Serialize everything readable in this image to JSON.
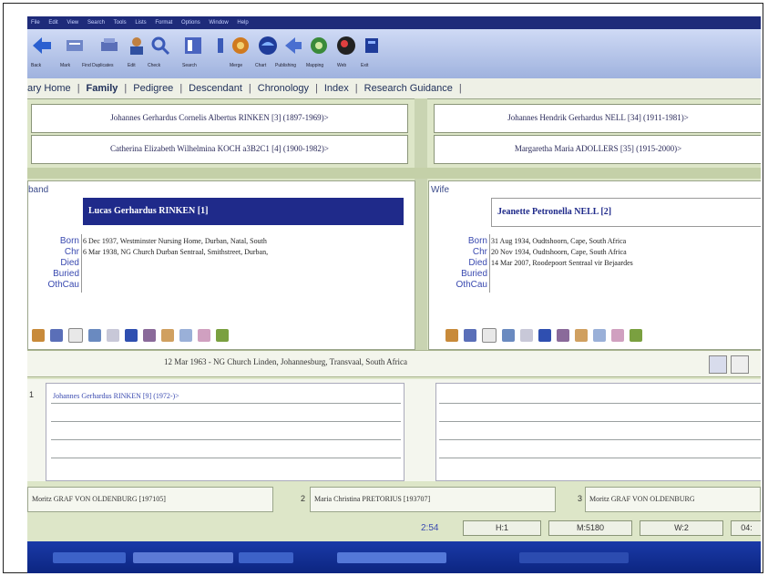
{
  "menu": [
    "File",
    "Edit",
    "View",
    "Search",
    "Tools",
    "Lists",
    "Format",
    "Options",
    "Window",
    "Help"
  ],
  "toolbar": {
    "labels": [
      "Back",
      "Mark",
      "Find Duplicates",
      "Edit",
      "Check",
      "Search",
      "Merge",
      "Chart",
      "Publishing",
      "Mapping",
      "Web",
      "Exit"
    ]
  },
  "tabs": [
    "ary Home",
    "Family",
    "Pedigree",
    "Descendant",
    "Chronology",
    "Index",
    "Research Guidance"
  ],
  "parents": {
    "husband_father": "Johannes Gerhardus Cornelis Albertus RINKEN [3] (1897-1969)>",
    "husband_mother": "Catherina Elizabeth Wilhelmina KOCH a3B2C1 [4] (1900-1982)>",
    "wife_father": "Johannes Hendrik Gerhardus NELL [34] (1911-1981)>",
    "wife_mother": "Margaretha Maria ADOLLERS [35] (1915-2000)>"
  },
  "husband": {
    "role": "band",
    "name": "Lucas Gerhardus RINKEN [1]",
    "events": [
      {
        "label": "Born",
        "value": "6 Dec 1937, Westminster Nursing Home, Durban, Natal, South"
      },
      {
        "label": "Chr",
        "value": "6 Mar 1938, NG Church Durban Sentraal, Smithstreet, Durban,"
      },
      {
        "label": "Died",
        "value": ""
      },
      {
        "label": "Buried",
        "value": ""
      },
      {
        "label": "OthCau",
        "value": ""
      }
    ]
  },
  "wife": {
    "role": "Wife",
    "name": "Jeanette Petronella NELL [2]",
    "events": [
      {
        "label": "Born",
        "value": "31 Aug 1934, Oudtshoorn, Cape, South Africa"
      },
      {
        "label": "Chr",
        "value": "20 Nov 1934, Oudtshoorn, Cape, South Africa"
      },
      {
        "label": "Died",
        "value": "14 Mar 2007, Roodepoort Sentraal vir Bejaardes"
      },
      {
        "label": "Buried",
        "value": ""
      },
      {
        "label": "OthCau",
        "value": ""
      }
    ]
  },
  "marriage": {
    "text": "12 Mar 1963 - NG Church Linden, Johannesburg, Transvaal, South Africa"
  },
  "children": {
    "index": "1",
    "first": "Johannes Gerhardus RINKEN [9] (1972-)>"
  },
  "spouses": [
    {
      "num": "1",
      "text": "Moritz GRAF VON OLDENBURG [197105]"
    },
    {
      "num": "2",
      "text": "Maria Christina PRETORIUS [193707]"
    },
    {
      "num": "3",
      "text": "Moritz GRAF VON OLDENBURG"
    }
  ],
  "statusbar": {
    "time": "2:54",
    "h": "H:1",
    "m": "M:5180",
    "w": "W:2",
    "f": "04:"
  },
  "colors": {
    "namebar_husband": "#1f2a8a",
    "namebar_wife": "#ffffff",
    "taskbar": "#1a3aa8"
  }
}
